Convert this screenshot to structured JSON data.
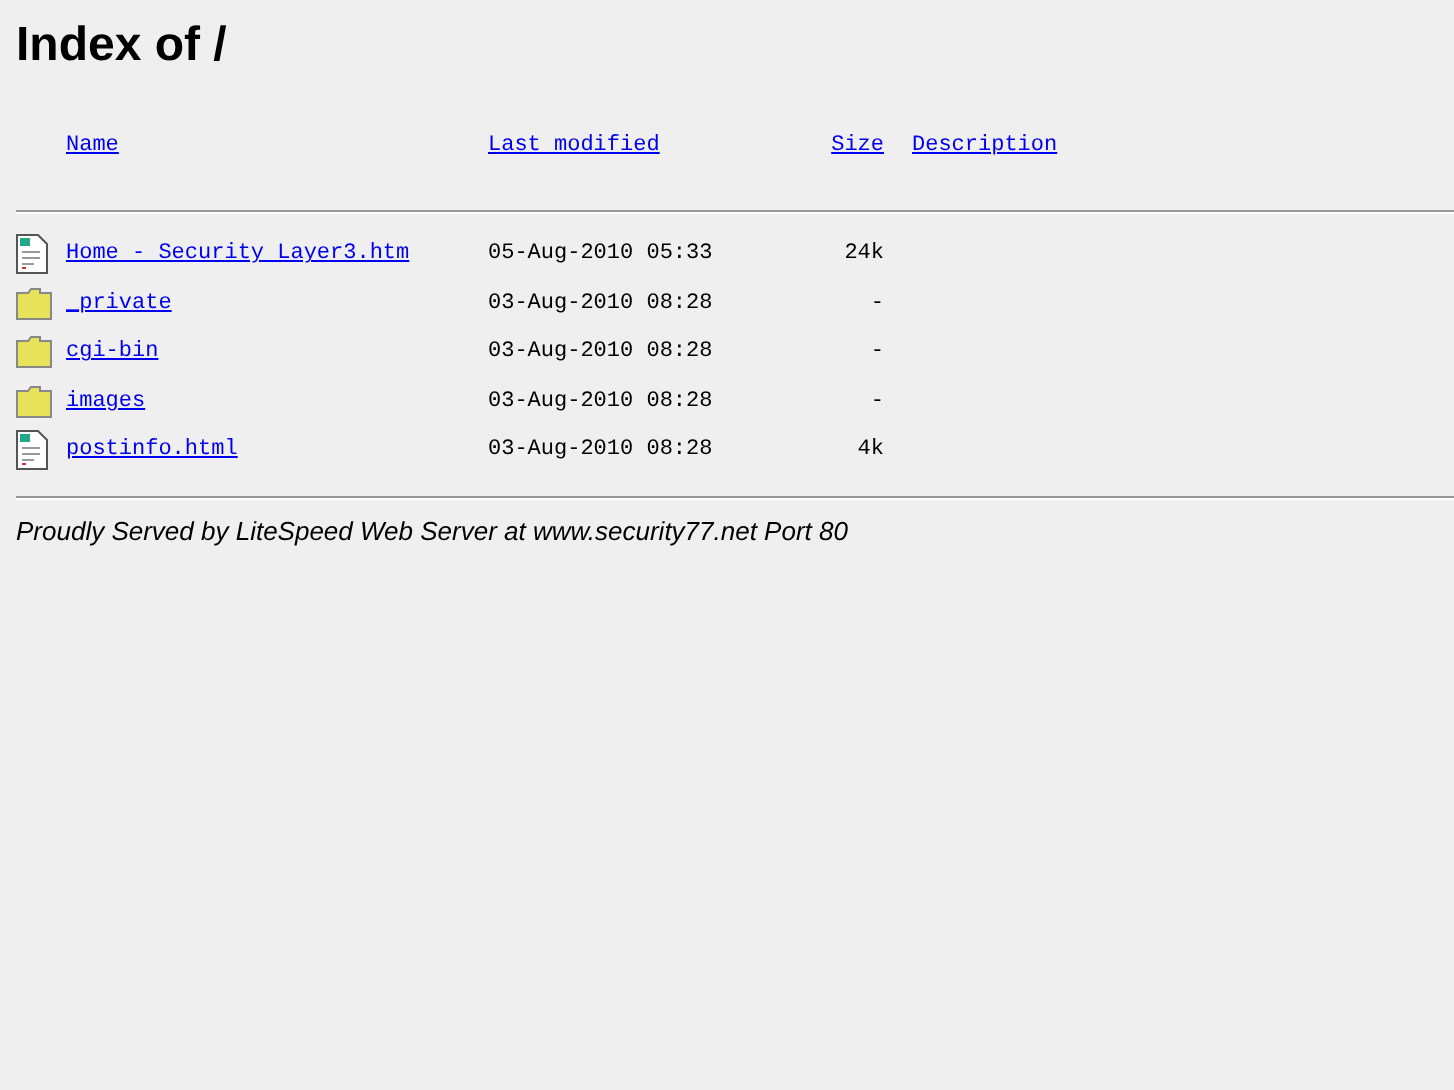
{
  "title": "Index of /",
  "columns": [
    "Name",
    "Last modified",
    "Size",
    "Description"
  ],
  "rows": [
    {
      "kind": "file",
      "name": "Home - Security Layer3.htm",
      "modified": "05-Aug-2010 05:33",
      "size": "24k"
    },
    {
      "kind": "folder",
      "name": "_private",
      "modified": "03-Aug-2010 08:28",
      "size": "-"
    },
    {
      "kind": "folder",
      "name": "cgi-bin",
      "modified": "03-Aug-2010 08:28",
      "size": "-"
    },
    {
      "kind": "folder",
      "name": "images",
      "modified": "03-Aug-2010 08:28",
      "size": "-"
    },
    {
      "kind": "file",
      "name": "postinfo.html",
      "modified": "03-Aug-2010 08:28",
      "size": "4k"
    }
  ],
  "footer": "Proudly Served by LiteSpeed Web Server at www.security77.net Port 80"
}
